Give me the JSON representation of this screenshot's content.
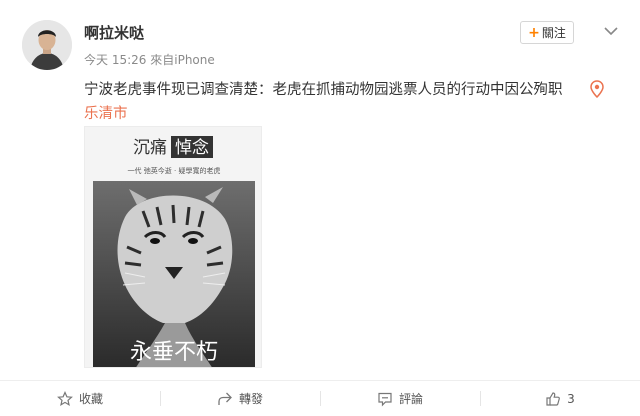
{
  "user": {
    "name": "啊拉米哒",
    "time": "今天 15:26",
    "source_prefix": "來自",
    "source": "iPhone"
  },
  "follow_label": "關注",
  "post": {
    "text": "宁波老虎事件现已调查清楚：老虎在抓捕动物园逃票人员的行动中因公殉职",
    "location": "乐清市"
  },
  "image": {
    "title_left": "沉痛",
    "title_right": "悼念",
    "subtitle": "一代 弛英今逝 · 疑學寬的老虎",
    "bottom_text": "永垂不朽"
  },
  "actions": {
    "favorite": "收藏",
    "repost": "轉發",
    "comment": "評論",
    "like_count": "3"
  },
  "colors": {
    "accent": "#ff8200",
    "location": "#eb7350"
  }
}
